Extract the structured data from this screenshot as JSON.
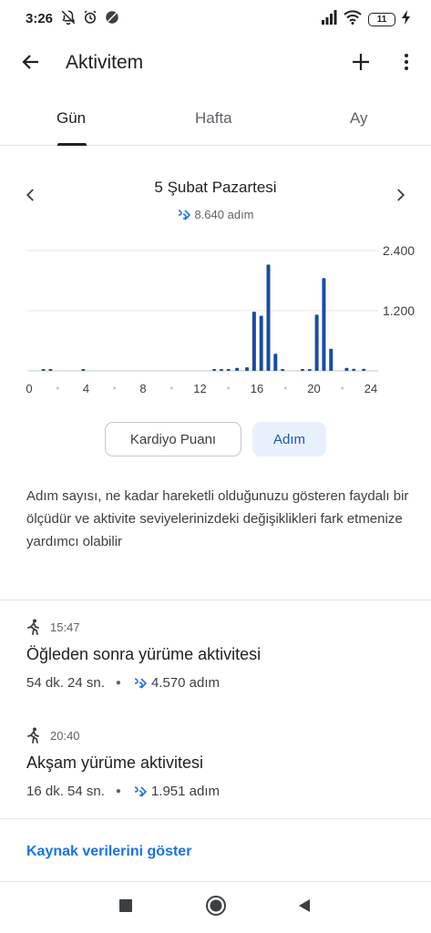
{
  "status_bar": {
    "time": "3:26",
    "battery": "11"
  },
  "app_bar": {
    "title": "Aktivitem"
  },
  "tabs": [
    {
      "label": "Gün",
      "active": true
    },
    {
      "label": "Hafta",
      "active": false
    },
    {
      "label": "Ay",
      "active": false
    }
  ],
  "date_nav": {
    "date": "5 Şubat Pazartesi",
    "steps": "8.640 adım"
  },
  "chart_data": {
    "type": "bar",
    "x_label_ticks": [
      "0",
      "4",
      "8",
      "12",
      "16",
      "20",
      "24"
    ],
    "y_label_ticks": [
      "2.400",
      "1.200"
    ],
    "ylim": [
      0,
      2400
    ],
    "xlim": [
      0,
      24
    ],
    "bar_color": "#1a4aa8",
    "x": [
      1.0,
      1.5,
      3.8,
      13.0,
      13.5,
      14.0,
      14.6,
      15.3,
      15.8,
      16.3,
      16.8,
      17.3,
      17.8,
      19.2,
      19.7,
      20.2,
      20.7,
      21.2,
      22.3,
      22.8,
      23.5
    ],
    "values": [
      10,
      10,
      30,
      20,
      25,
      30,
      60,
      70,
      1180,
      1100,
      2120,
      340,
      30,
      20,
      30,
      1120,
      1850,
      440,
      60,
      40,
      40
    ]
  },
  "toggle": {
    "cardio_label": "Kardiyo Puanı",
    "steps_label": "Adım"
  },
  "description": "Adım sayısı, ne kadar hareketli olduğunuzu gösteren faydalı bir ölçüdür ve aktivite seviyelerinizdeki değişiklikleri fark etmenize yardımcı olabilir",
  "activities": [
    {
      "time": "15:47",
      "title": "Öğleden sonra yürüme aktivitesi",
      "duration": "54 dk. 24 sn.",
      "steps": "4.570 adım"
    },
    {
      "time": "20:40",
      "title": "Akşam yürüme aktivitesi",
      "duration": "16 dk. 54 sn.",
      "steps": "1.951 adım"
    }
  ],
  "source_link": "Kaynak verilerini göster",
  "colors": {
    "accent": "#1a73e8",
    "bar": "#1a4aa8",
    "chip_bg": "#e8f0fe"
  }
}
